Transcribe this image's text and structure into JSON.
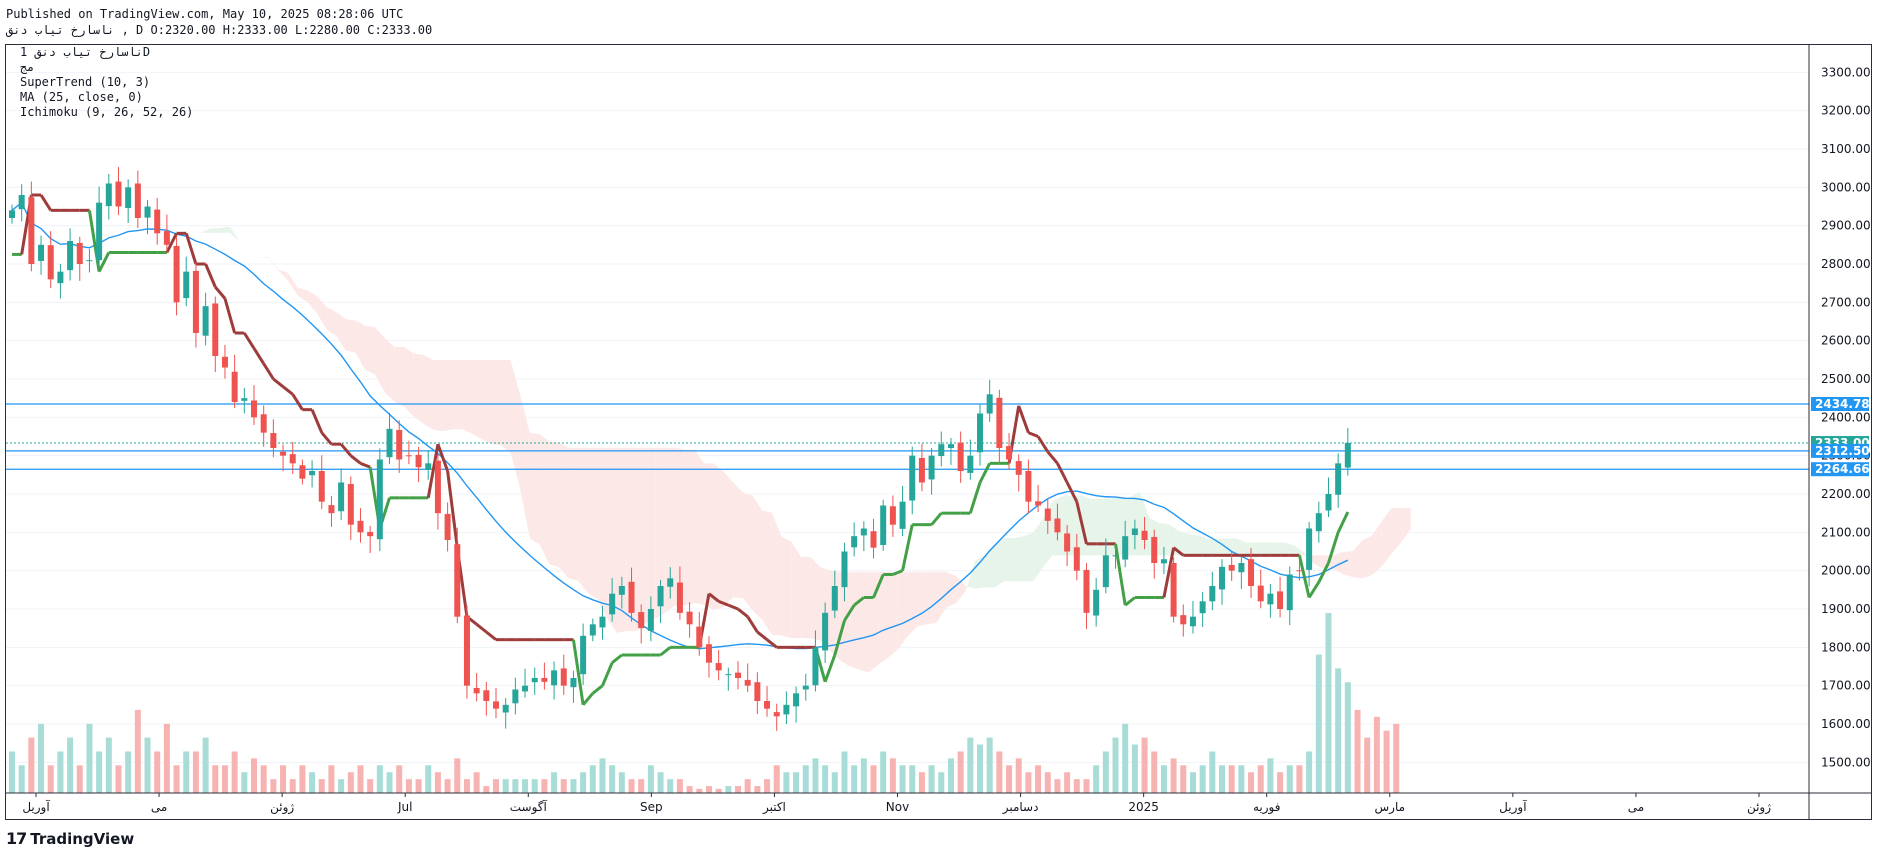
{
  "header": {
    "published": "Published on TradingView.com, May 10, 2025 08:28:06 UTC",
    "symbol_line": "ناسارخ تیاب دنق , D O:2320.00 H:2333.00 L:2280.00 C:2333.00"
  },
  "legend": {
    "symbol": "ناسارخ تیاب دنق 1D",
    "exchange": "مج",
    "supertrend": "SuperTrend (10, 3)",
    "ma": "MA (25, close, 0)",
    "ichimoku": "Ichimoku (9, 26, 52, 26)"
  },
  "footer": {
    "logo_mark": "17",
    "brand": "TradingView"
  },
  "colors": {
    "up": "#26a69a",
    "down": "#ef5350",
    "supertrend_up": "#43a047",
    "supertrend_down": "#9e3b3b",
    "ma": "#2196f3",
    "cloud_bull": "#e6f4ea",
    "cloud_bear": "#fde8e8",
    "hline": "#2196f3",
    "last_price": "#26a69a"
  },
  "chart_data": {
    "type": "candlestick",
    "x_labels": [
      "آوریل",
      "می",
      "ژوئن",
      "Jul",
      "آگوست",
      "Sep",
      "اکتبر",
      "Nov",
      "دسامبر",
      "2025",
      "فوریه",
      "مارس",
      "آوریل",
      "می",
      "ژوئن"
    ],
    "y_ticks": [
      1500,
      1600,
      1700,
      1800,
      1900,
      2000,
      2100,
      2200,
      2300,
      2400,
      2500,
      2600,
      2700,
      2800,
      2900,
      3000,
      3100,
      3200,
      3300
    ],
    "ylim": [
      1420,
      3340
    ],
    "horizontal_lines": [
      2434.78,
      2312.5,
      2264.66
    ],
    "price_tags": [
      {
        "label": "2434.78",
        "value": 2434.78,
        "color": "#2196f3"
      },
      {
        "label": "2333.00",
        "value": 2333.0,
        "color": "#26a69a"
      },
      {
        "label": "2312.50",
        "value": 2312.5,
        "color": "#2196f3"
      },
      {
        "label": "2264.66",
        "value": 2264.66,
        "color": "#2196f3"
      }
    ],
    "last_price": 2333.0,
    "close": [
      2940,
      2980,
      2800,
      2850,
      2760,
      2780,
      2860,
      2800,
      2810,
      2960,
      3010,
      2950,
      3000,
      2920,
      2950,
      2880,
      2850,
      2700,
      2780,
      2620,
      2690,
      2560,
      2530,
      2440,
      2450,
      2400,
      2360,
      2320,
      2300,
      2280,
      2240,
      2260,
      2180,
      2150,
      2230,
      2120,
      2100,
      2090,
      2290,
      2370,
      2290,
      2300,
      2270,
      2280,
      2150,
      2080,
      1880,
      1700,
      1680,
      1660,
      1640,
      1650,
      1690,
      1700,
      1720,
      1710,
      1740,
      1700,
      1720,
      1830,
      1860,
      1880,
      1940,
      1960,
      1890,
      1850,
      1900,
      1960,
      1980,
      1890,
      1860,
      1800,
      1760,
      1740,
      1730,
      1720,
      1700,
      1660,
      1640,
      1620,
      1650,
      1680,
      1700,
      1800,
      1890,
      1960,
      2050,
      2090,
      2110,
      2060,
      2170,
      2120,
      2180,
      2300,
      2230,
      2300,
      2330,
      2330,
      2260,
      2300,
      2410,
      2460,
      2320,
      2290,
      2250,
      2180,
      2170,
      2130,
      2100,
      2050,
      2000,
      1890,
      1950,
      2040,
      2040,
      2090,
      2110,
      2080,
      2020,
      2030,
      1880,
      1860,
      1880,
      1920,
      1960,
      2010,
      2000,
      2020,
      1960,
      1920,
      1940,
      1900,
      1990,
      2000,
      2110,
      2150,
      2200,
      2280,
      2333
    ],
    "volume": [
      3,
      2,
      4,
      5,
      2,
      3,
      4,
      2,
      5,
      3,
      4,
      2,
      3,
      6,
      4,
      3,
      5,
      2,
      3,
      3,
      4,
      2,
      2,
      3,
      1.5,
      2.5,
      2,
      1,
      2,
      1,
      2,
      1.5,
      1,
      2,
      1,
      1.5,
      2,
      1,
      2,
      1.5,
      2,
      1,
      1,
      2,
      1.5,
      1,
      2.5,
      1,
      1.5,
      0.5,
      1,
      1,
      1,
      1,
      1,
      1,
      1.5,
      1,
      1,
      1.5,
      2,
      2.5,
      2,
      1.5,
      1,
      1,
      2,
      1.5,
      1,
      1,
      0.5,
      0.3,
      0.5,
      0.3,
      0.5,
      0.5,
      1,
      0.5,
      1,
      2,
      1.5,
      1.5,
      2,
      2.5,
      2,
      1.5,
      3,
      2,
      2.5,
      2,
      3,
      2.5,
      2,
      2,
      1.5,
      2,
      1.5,
      2.5,
      3,
      4,
      3.5,
      4,
      3,
      2,
      2.5,
      1.5,
      2,
      1.5,
      1,
      1.5,
      1,
      1,
      2,
      3,
      4,
      5,
      3.5,
      4,
      3,
      2,
      2.5,
      2,
      1.5,
      2,
      3,
      2,
      2,
      2,
      1.5,
      2,
      2.5,
      1.5,
      2,
      2,
      3,
      10,
      13,
      9,
      8,
      6,
      4,
      5.5,
      4.5,
      5
    ]
  }
}
